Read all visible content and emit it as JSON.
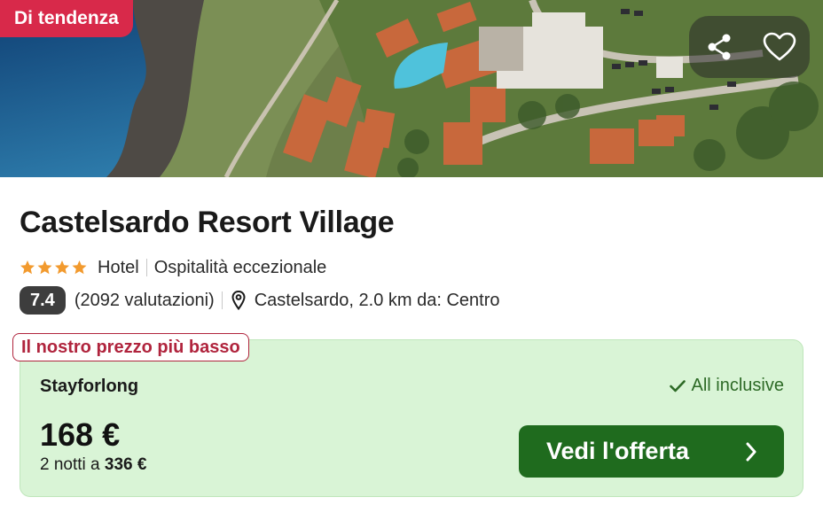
{
  "hero": {
    "badge": "Di tendenza",
    "share_icon": "share-icon",
    "favorite_icon": "heart-icon"
  },
  "hotel": {
    "name": "Castelsardo Resort Village",
    "stars": 4,
    "type": "Hotel",
    "hospitality": "Ospitalità eccezionale",
    "score": "7.4",
    "reviews": "(2092 valutazioni)",
    "location": "Castelsardo, 2.0 km da: Centro"
  },
  "offer": {
    "tag": "Il nostro prezzo più basso",
    "provider": "Stayforlong",
    "board": "All inclusive",
    "price": "168 €",
    "nights_prefix": "2 notti a",
    "total": "336 €",
    "cta_label": "Vedi l'offerta"
  },
  "colors": {
    "trend_badge": "#d8294a",
    "card_bg": "#d9f4d6",
    "cta_bg": "#1f6b1e",
    "tag_text": "#b0243d",
    "star": "#f29a2e"
  }
}
